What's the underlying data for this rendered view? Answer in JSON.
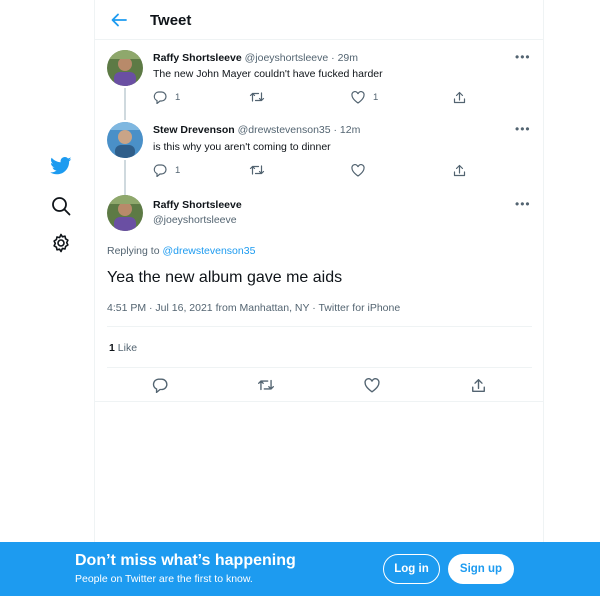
{
  "colors": {
    "brand": "#1d9bf0",
    "text_primary": "#0f1419",
    "text_secondary": "#536471",
    "border": "#eff3f4"
  },
  "nav": {
    "icons": [
      "twitter-logo-icon",
      "search-icon",
      "gear-icon"
    ]
  },
  "header": {
    "back_icon": "arrow-left-icon",
    "title": "Tweet"
  },
  "thread": [
    {
      "name": "Raffy Shortsleeve",
      "handle": "@joeyshortsleeve",
      "time": "· 29m",
      "text": "The new John Mayer couldn't have fucked harder",
      "reply_count": "1",
      "retweet_count": "",
      "like_count": "1"
    },
    {
      "name": "Stew Drevenson",
      "handle": "@drewstevenson35",
      "time": "· 12m",
      "text": "is this why you aren't coming to dinner",
      "reply_count": "1",
      "retweet_count": "",
      "like_count": ""
    }
  ],
  "main_tweet": {
    "name": "Raffy Shortsleeve",
    "handle": "@joeyshortsleeve",
    "replying_prefix": "Replying to",
    "replying_to": "@drewstevenson35",
    "text": "Yea the new album gave me aids",
    "meta": "4:51 PM · Jul 16, 2021 from Manhattan, NY · Twitter for iPhone",
    "like_count": "1",
    "like_label": "Like"
  },
  "banner": {
    "title": "Don’t miss what’s happening",
    "subtitle": "People on Twitter are the first to know.",
    "login_label": "Log in",
    "signup_label": "Sign up"
  }
}
